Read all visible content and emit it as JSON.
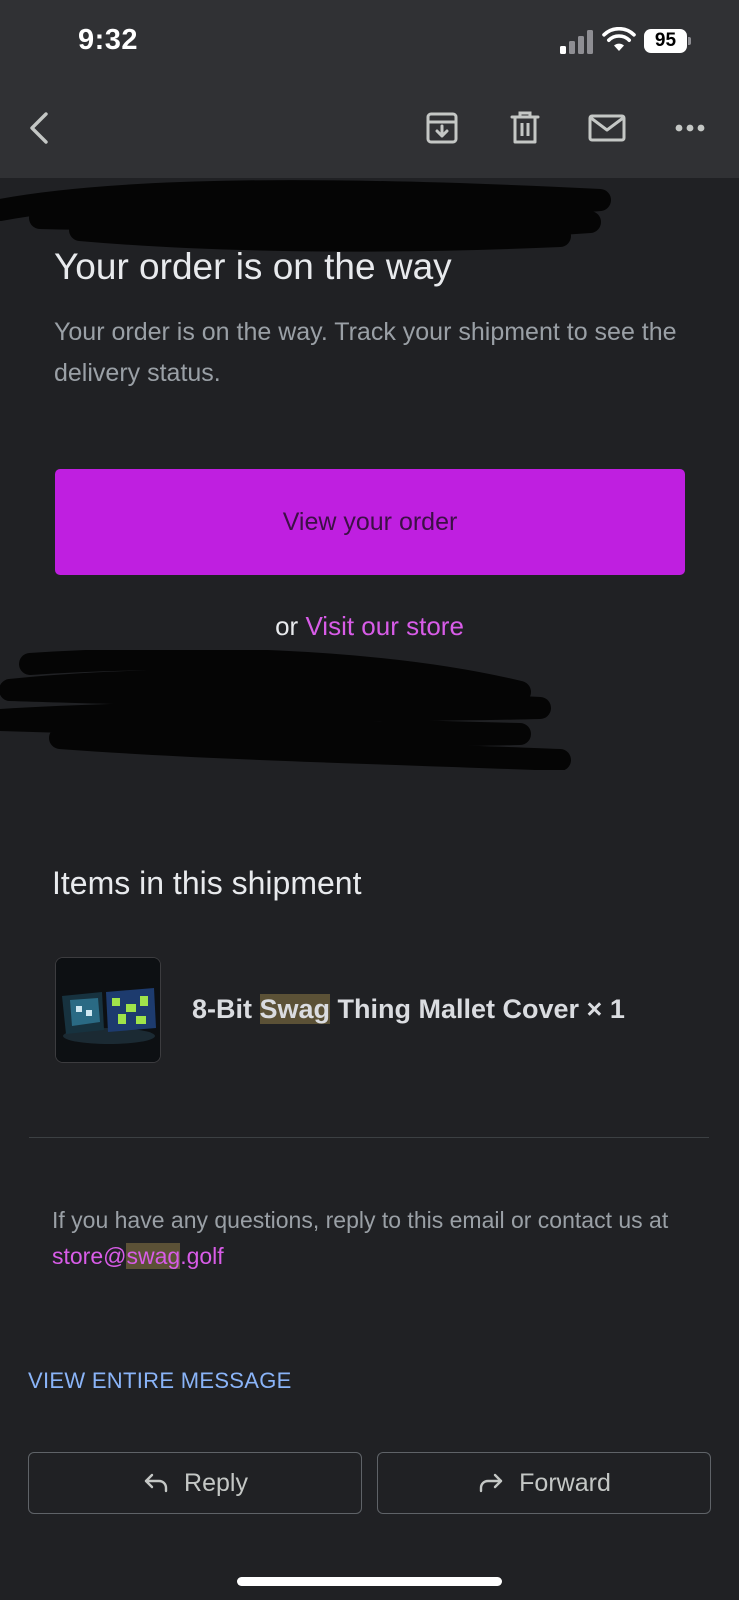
{
  "status_bar": {
    "time": "9:32",
    "battery": "95"
  },
  "toolbar": {
    "icons": [
      "back-icon",
      "archive-icon",
      "delete-icon",
      "mark-unread-icon",
      "more-icon"
    ]
  },
  "email": {
    "headline": "Your order is on the way",
    "subtext": "Your order is on the way. Track your shipment to see the delivery status.",
    "cta_label": "View your order",
    "or_text": "or",
    "visit_store_label": "Visit our store",
    "items_heading": "Items in this shipment",
    "product": {
      "title_prefix": "8-Bit ",
      "title_highlight": "Swag",
      "title_suffix": " Thing Mallet Cover × 1"
    },
    "contact_text": "If you have any questions, reply to this email or contact us at ",
    "contact_email_prefix": "store@",
    "contact_email_highlight": "swag",
    "contact_email_suffix": ".golf"
  },
  "footer": {
    "view_entire_label": "VIEW ENTIRE MESSAGE",
    "reply_label": "Reply",
    "forward_label": "Forward"
  },
  "colors": {
    "background": "#202124",
    "toolbar": "#303134",
    "accent_button": "#bf1fe0",
    "link": "#d85ce8",
    "view_entire_link": "#8ab4f8",
    "highlight": "#5b5136"
  }
}
